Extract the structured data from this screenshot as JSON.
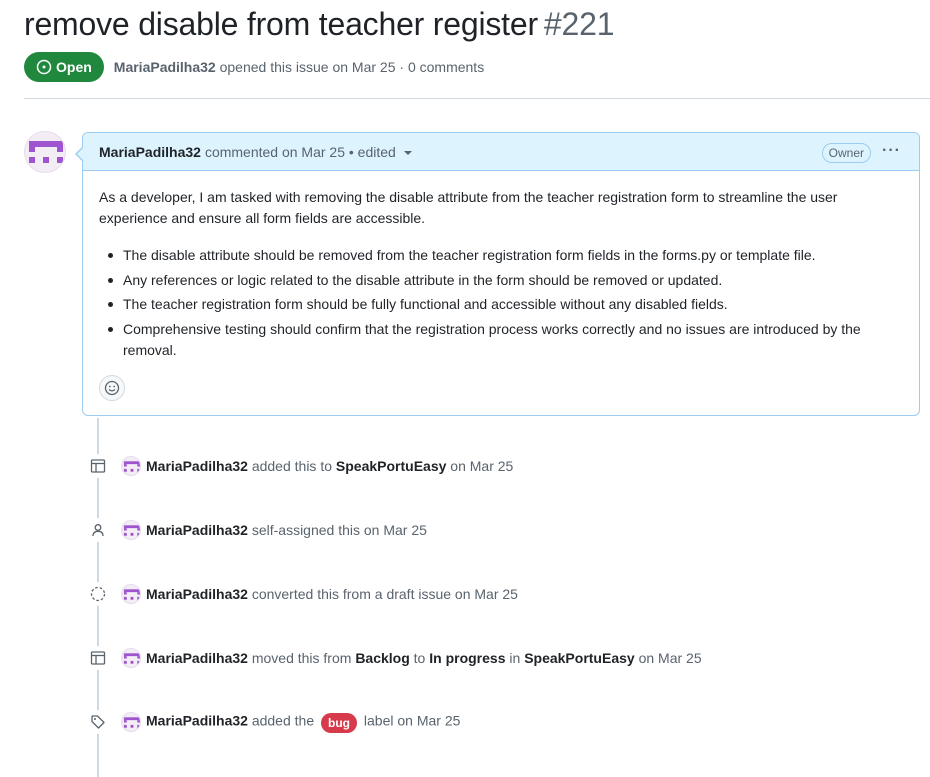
{
  "issue": {
    "title": "remove disable from teacher register",
    "number": "#221",
    "state": "Open",
    "author": "MariaPadilha32",
    "opened_text": "opened this issue on Mar 25 · 0 comments"
  },
  "comment": {
    "author": "MariaPadilha32",
    "meta": "commented on Mar 25 • edited",
    "role_badge": "Owner",
    "menu_label": "···",
    "intro": "As a developer, I am tasked with removing the disable attribute from the teacher registration form to streamline the user experience and ensure all form fields are accessible.",
    "bullets": [
      "The disable attribute should be removed from the teacher registration form fields in the forms.py or template file.",
      "Any references or logic related to the disable attribute in the form should be removed or updated.",
      "The teacher registration form should be fully functional and accessible without any disabled fields.",
      "Comprehensive testing should confirm that the registration process works correctly and no issues are introduced by the removal."
    ]
  },
  "timeline": [
    {
      "icon": "table-icon",
      "actor": "MariaPadilha32",
      "text1": "added this to",
      "bold1": "SpeakPortuEasy",
      "text2": "on Mar 25"
    },
    {
      "icon": "person-icon",
      "actor": "MariaPadilha32",
      "text1": "self-assigned this on Mar 25"
    },
    {
      "icon": "dashed-circle-icon",
      "actor": "MariaPadilha32",
      "text1": "converted this from a draft issue on Mar 25"
    },
    {
      "icon": "table-icon",
      "actor": "MariaPadilha32",
      "text1": "moved this from",
      "bold1": "Backlog",
      "text2": "to",
      "bold2": "In progress",
      "text3": "in",
      "bold3": "SpeakPortuEasy",
      "text4": "on Mar 25"
    },
    {
      "icon": "tag-icon",
      "actor": "MariaPadilha32",
      "text1": "added the",
      "label": "bug",
      "text2": "label on Mar 25"
    }
  ],
  "colors": {
    "open_green": "#1f883d",
    "comment_header_bg": "#ddf4ff",
    "comment_border": "#9ecbf0",
    "bug_label": "#d73a4a",
    "avatar_purple": "#a055d0"
  }
}
